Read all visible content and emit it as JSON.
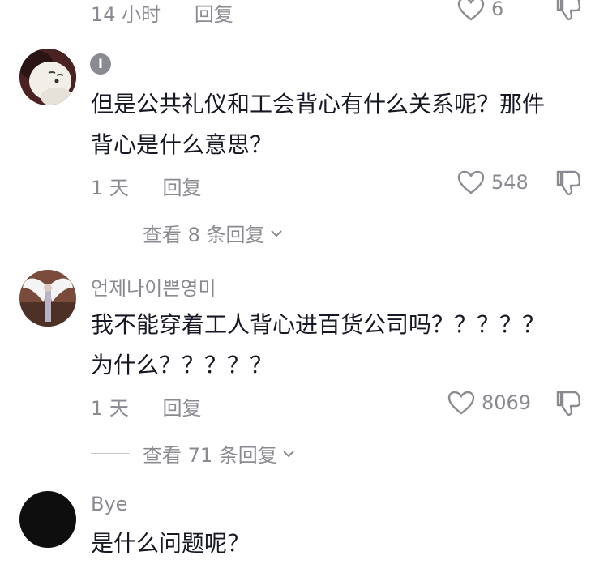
{
  "top_comment": {
    "time": "14 小时",
    "reply_label": "回复",
    "likes": "6"
  },
  "comments": [
    {
      "username": "I",
      "text_line1": "但是公共礼仪和工会背心有什么关系呢？那件",
      "text_line2": "背心是什么意思？",
      "time": "1 天",
      "reply_label": "回复",
      "likes": "548",
      "view_replies": "查看 8 条回复"
    },
    {
      "username": "언제나이쁜영미",
      "text_line1": "我不能穿着工人背心进百货公司吗？？？？？",
      "text_line2": "为什么？？？？？",
      "time": "1 天",
      "reply_label": "回复",
      "likes": "8069",
      "view_replies": "查看 71 条回复"
    },
    {
      "username": "Bye",
      "text_line1": "是什么问题呢？"
    }
  ],
  "icons": {
    "like": "heart-outline-icon",
    "dislike": "thumbs-down-outline-icon",
    "expand": "chevron-down-icon"
  },
  "colors": {
    "text": "#161823",
    "secondary": "#8a8b91",
    "background": "#ffffff"
  }
}
